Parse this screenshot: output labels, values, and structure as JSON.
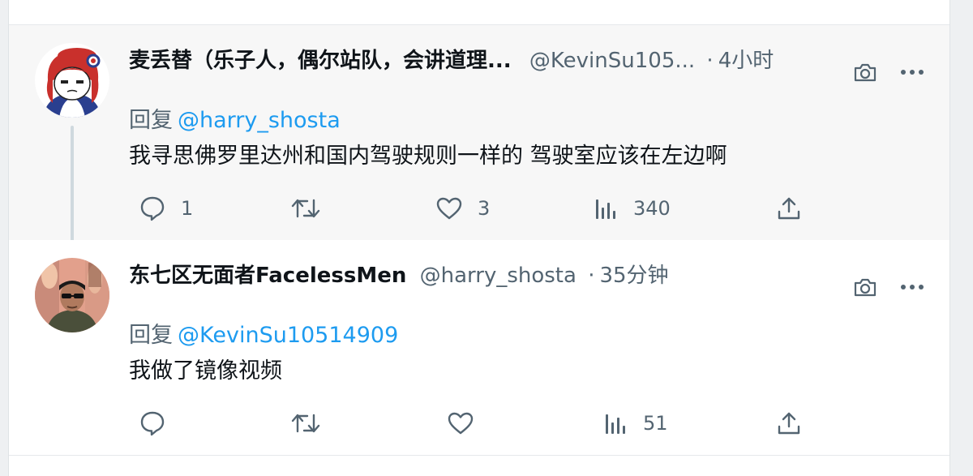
{
  "tweets": [
    {
      "display_name": "麦丢替（乐子人，偶尔站队，会讲道理...",
      "handle": "@KevinSu105...",
      "separator": "·",
      "time": "4小时",
      "reply_prefix": "回复",
      "reply_to": "@harry_shosta",
      "text": "我寻思佛罗里达州和国内驾驶规则一样的 驾驶室应该在左边啊",
      "replies": "1",
      "retweets": "",
      "likes": "3",
      "views": "340"
    },
    {
      "display_name": "东七区无面者FacelessMen",
      "handle": "@harry_shosta",
      "separator": "·",
      "time": "35分钟",
      "reply_prefix": "回复",
      "reply_to": "@KevinSu10514909",
      "text": "我做了镜像视频",
      "replies": "",
      "retweets": "",
      "likes": "",
      "views": "51"
    }
  ],
  "icons": {
    "reply": "speech-bubble-icon",
    "retweet": "retweet-arrows-icon",
    "like": "heart-outline-icon",
    "views": "bar-chart-icon",
    "share": "upload-share-icon",
    "camera": "camera-icon",
    "more": "more-dots-icon"
  },
  "colors": {
    "link": "#1d9bf0",
    "secondary_text": "#536471",
    "primary_text": "#0f1419",
    "highlight_bg": "#f7f7f7"
  }
}
